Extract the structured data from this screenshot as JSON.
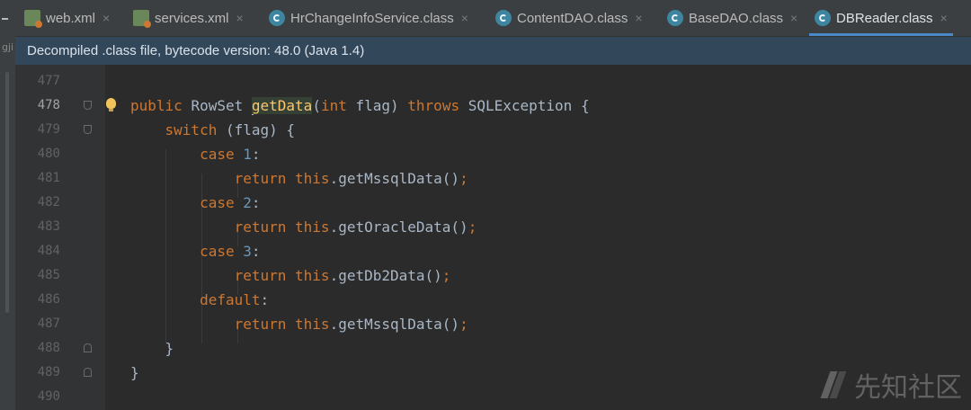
{
  "tabs": [
    {
      "label": "web.xml",
      "icon": "xml-file-icon",
      "active": false
    },
    {
      "label": "services.xml",
      "icon": "xml-file-icon",
      "active": false
    },
    {
      "label": "HrChangeInfoService.class",
      "icon": "class-file-icon",
      "active": false
    },
    {
      "label": "ContentDAO.class",
      "icon": "class-file-icon",
      "active": false
    },
    {
      "label": "BaseDAO.class",
      "icon": "class-file-icon",
      "active": false
    },
    {
      "label": "DBReader.class",
      "icon": "class-file-icon",
      "active": true
    }
  ],
  "close_glyph": "×",
  "left_strip_text": "gji",
  "banner": {
    "text": "Decompiled .class file, bytecode version: 48.0 (Java 1.4)"
  },
  "editor": {
    "current_line": 478,
    "lines": [
      {
        "num": "477",
        "tokens": []
      },
      {
        "num": "478",
        "tokens": [
          {
            "t": "public ",
            "c": "kw"
          },
          {
            "t": "RowSet ",
            "c": ""
          },
          {
            "t": "getData",
            "c": "hl"
          },
          {
            "t": "(",
            "c": ""
          },
          {
            "t": "int ",
            "c": "kw"
          },
          {
            "t": "flag) ",
            "c": ""
          },
          {
            "t": "throws ",
            "c": "kw"
          },
          {
            "t": "SQLException {",
            "c": ""
          }
        ]
      },
      {
        "num": "479",
        "tokens": [
          {
            "t": "    switch ",
            "c": "kw"
          },
          {
            "t": "(flag) {",
            "c": ""
          }
        ]
      },
      {
        "num": "480",
        "tokens": [
          {
            "t": "        case ",
            "c": "kw"
          },
          {
            "t": "1",
            "c": "num"
          },
          {
            "t": ":",
            "c": ""
          }
        ]
      },
      {
        "num": "481",
        "tokens": [
          {
            "t": "            return this",
            "c": "kw"
          },
          {
            "t": ".getMssqlData()",
            "c": ""
          },
          {
            "t": ";",
            "c": "kw"
          }
        ]
      },
      {
        "num": "482",
        "tokens": [
          {
            "t": "        case ",
            "c": "kw"
          },
          {
            "t": "2",
            "c": "num"
          },
          {
            "t": ":",
            "c": ""
          }
        ]
      },
      {
        "num": "483",
        "tokens": [
          {
            "t": "            return this",
            "c": "kw"
          },
          {
            "t": ".getOracleData()",
            "c": ""
          },
          {
            "t": ";",
            "c": "kw"
          }
        ]
      },
      {
        "num": "484",
        "tokens": [
          {
            "t": "        case ",
            "c": "kw"
          },
          {
            "t": "3",
            "c": "num"
          },
          {
            "t": ":",
            "c": ""
          }
        ]
      },
      {
        "num": "485",
        "tokens": [
          {
            "t": "            return this",
            "c": "kw"
          },
          {
            "t": ".getDb2Data()",
            "c": ""
          },
          {
            "t": ";",
            "c": "kw"
          }
        ]
      },
      {
        "num": "486",
        "tokens": [
          {
            "t": "        default",
            "c": "kw"
          },
          {
            "t": ":",
            "c": ""
          }
        ]
      },
      {
        "num": "487",
        "tokens": [
          {
            "t": "            return this",
            "c": "kw"
          },
          {
            "t": ".getMssqlData()",
            "c": ""
          },
          {
            "t": ";",
            "c": "kw"
          }
        ]
      },
      {
        "num": "488",
        "tokens": [
          {
            "t": "    }",
            "c": ""
          }
        ]
      },
      {
        "num": "489",
        "tokens": [
          {
            "t": "}",
            "c": ""
          }
        ]
      },
      {
        "num": "490",
        "tokens": []
      }
    ]
  },
  "watermark": {
    "text": "先知社区"
  },
  "colors": {
    "keyword": "#cc7832",
    "number": "#6897bb",
    "method": "#ffc66d",
    "background": "#2b2b2b",
    "banner": "#33475b",
    "active_tab_underline": "#4a88c7"
  }
}
